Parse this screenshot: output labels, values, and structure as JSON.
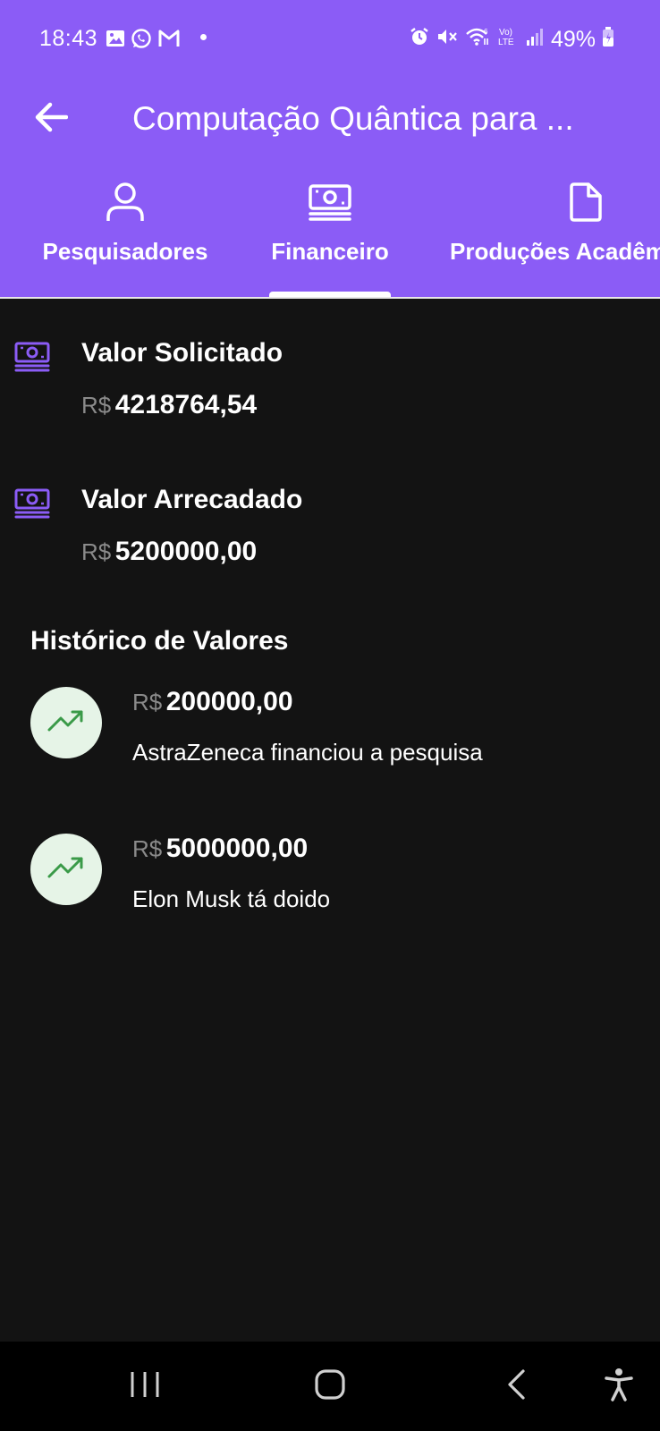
{
  "status_bar": {
    "time": "18:43",
    "battery": "49%",
    "left_icons": [
      "gallery-icon",
      "whatsapp-icon",
      "gmail-icon"
    ],
    "right_icons": [
      "alarm-icon",
      "mute-icon",
      "wifi-icon",
      "volte-icon",
      "signal-icon",
      "battery-icon"
    ]
  },
  "app_bar": {
    "title": "Computação Quântica para ...",
    "back_icon": "arrow-left-icon"
  },
  "tabs": [
    {
      "label": "Pesquisadores",
      "icon": "person-icon",
      "selected": false
    },
    {
      "label": "Financeiro",
      "icon": "money-icon",
      "selected": true
    },
    {
      "label": "Produções Acadêm",
      "icon": "document-icon",
      "selected": false
    }
  ],
  "finance": {
    "requested": {
      "title": "Valor Solicitado",
      "currency": "R$",
      "amount": "4218764,54"
    },
    "raised": {
      "title": "Valor Arrecadado",
      "currency": "R$",
      "amount": "5200000,00"
    }
  },
  "history": {
    "title": "Histórico de Valores",
    "items": [
      {
        "currency": "R$",
        "amount": "200000,00",
        "description": "AstraZeneca financiou a pesquisa",
        "icon": "trending-up-icon"
      },
      {
        "currency": "R$",
        "amount": "5000000,00",
        "description": "Elon Musk tá doido",
        "icon": "trending-up-icon"
      }
    ]
  },
  "colors": {
    "header": "#8b5cf6",
    "background": "#131313",
    "accent_icon": "#8b5cf6",
    "trend_circle": "#e6f4e7",
    "trend_arrow": "#3a9a48",
    "currency_text": "#8a8a8a"
  },
  "nav_bar": {
    "buttons": [
      "recents-icon",
      "home-icon",
      "back-icon",
      "accessibility-icon"
    ]
  }
}
